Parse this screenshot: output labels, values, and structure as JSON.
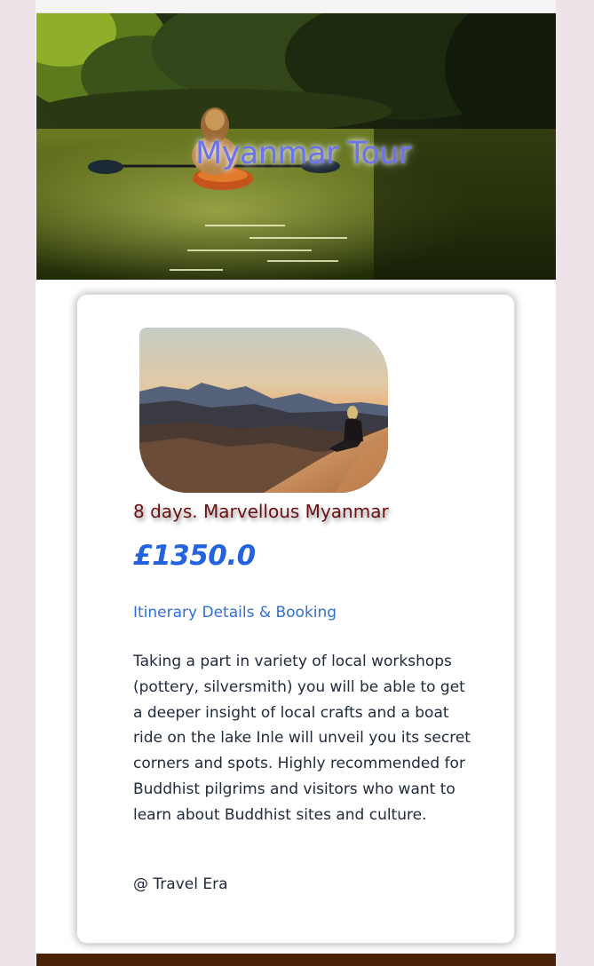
{
  "hero": {
    "title": "Myanmar Tour",
    "image": "kayaker-on-jungle-river"
  },
  "card": {
    "image": "woman-sitting-on-desert-dune-at-sunset",
    "title": "8 days. Marvellous Myanmar",
    "price": "£1350.0",
    "link_label": "Itinerary Details & Booking",
    "description": "Taking a part in variety of local workshops (pottery, silversmith) you will be able to get a deeper insight of local crafts and a boat ride on the lake Inle will unveil you its secret corners and spots. Highly recommended for Buddhist pilgrims and visitors who want to learn about Buddhist sites and culture.",
    "credit": "@ Travel Era"
  },
  "colors": {
    "page_background": "#efe3ea",
    "hero_title": "#6a72ee",
    "card_title": "#6b1010",
    "price": "#2463e0",
    "link": "#2f6fd8",
    "body_text": "#212b3b",
    "footer": "#4a2208"
  }
}
